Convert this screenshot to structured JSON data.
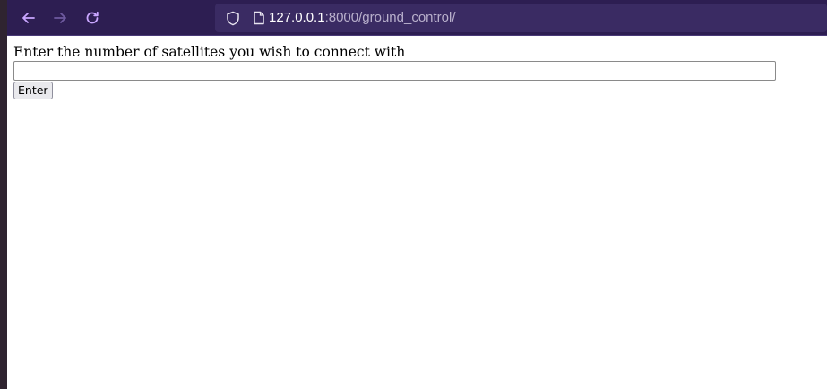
{
  "browser": {
    "url_host": "127.0.0.1",
    "url_rest": ":8000/ground_control/",
    "icons": {
      "back": "arrow-left-icon",
      "forward": "arrow-right-icon",
      "reload": "reload-icon",
      "tracking_protection": "shield-icon",
      "page_info": "page-icon"
    },
    "colors": {
      "toolbar": "#2d1e52",
      "urlbar": "#3a2b63",
      "icon_active": "#c9a6ff",
      "icon_disabled": "#6e5aa0"
    }
  },
  "form": {
    "prompt": "Enter the number of satellites you wish to connect with",
    "input_value": "",
    "submit_label": "Enter"
  }
}
